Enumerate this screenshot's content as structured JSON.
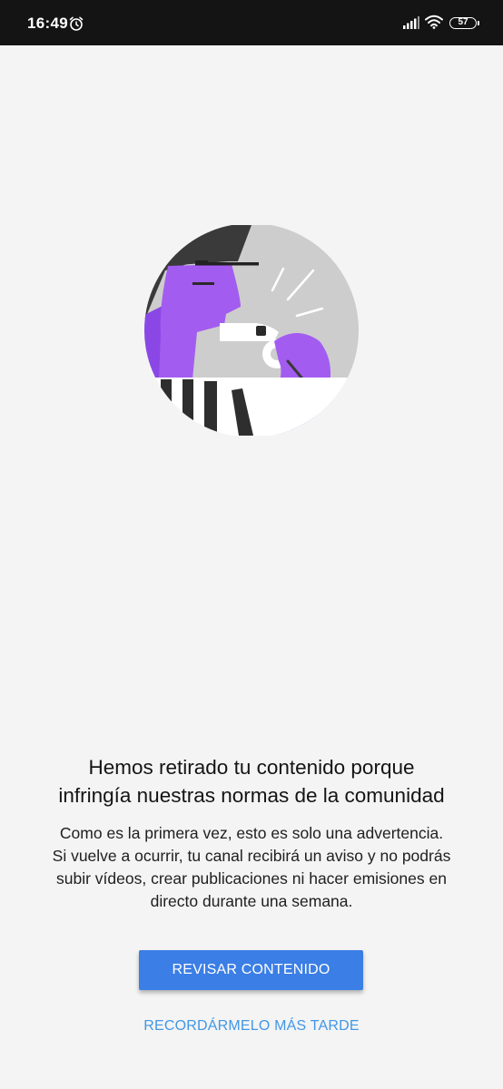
{
  "status_bar": {
    "time": "16:49",
    "battery_level": "57",
    "icons": [
      "alarm-icon",
      "signal-icon",
      "wifi-icon",
      "battery-icon"
    ]
  },
  "illustration": {
    "description_icon": "referee-whistle-illustration",
    "colors": {
      "purple": "#a35cf0",
      "dark_purple": "#8b47e6",
      "gray": "#cdcdcd",
      "dark": "#3a3a3a",
      "white": "#ffffff"
    }
  },
  "content": {
    "headline_line1": "Hemos retirado tu contenido porque",
    "headline_line2": "infringía nuestras normas de la comunidad",
    "body_line1": "Como es la primera vez, esto es solo una advertencia.",
    "body_line2": "Si vuelve a ocurrir, tu canal recibirá un aviso y no podrás",
    "body_line3": "subir vídeos, crear publicaciones ni hacer emisiones en",
    "body_line4": "directo durante una semana."
  },
  "actions": {
    "review_label": "REVISAR CONTENIDO",
    "remind_label": "RECORDÁRMELO MÁS TARDE"
  },
  "colors": {
    "background": "#f4f4f4",
    "status_bar": "#141414",
    "primary_button": "#3b7ee6",
    "secondary_text": "#4297e6"
  }
}
